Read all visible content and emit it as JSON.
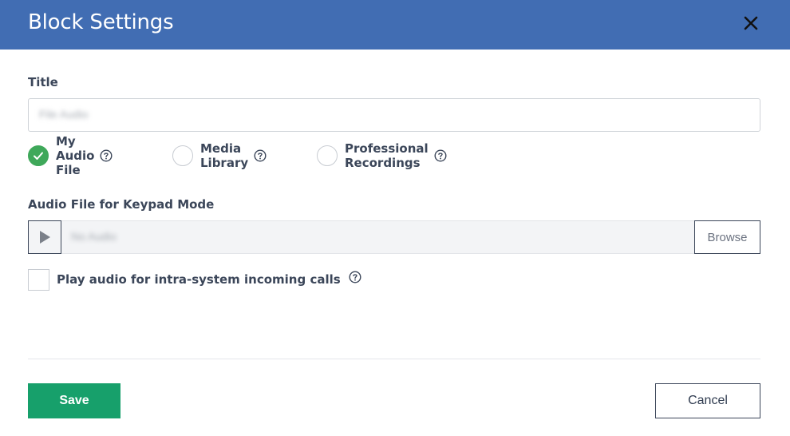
{
  "dialog": {
    "title": "Block Settings",
    "close_icon": "close-icon"
  },
  "title_field": {
    "label": "Title",
    "value": "File Audio"
  },
  "source_options": [
    {
      "label": "My Audio File",
      "checked": true
    },
    {
      "label": "Media Library",
      "checked": false
    },
    {
      "label": "Professional Recordings",
      "checked": false
    }
  ],
  "audio_file": {
    "label": "Audio File for Keypad Mode",
    "value": "No Audio",
    "browse_label": "Browse"
  },
  "intra_system": {
    "label": "Play audio for intra-system incoming calls",
    "checked": false
  },
  "footer": {
    "save_label": "Save",
    "cancel_label": "Cancel"
  },
  "colors": {
    "header": "#416db3",
    "save": "#17a06b",
    "radio_checked": "#3fa85a"
  }
}
